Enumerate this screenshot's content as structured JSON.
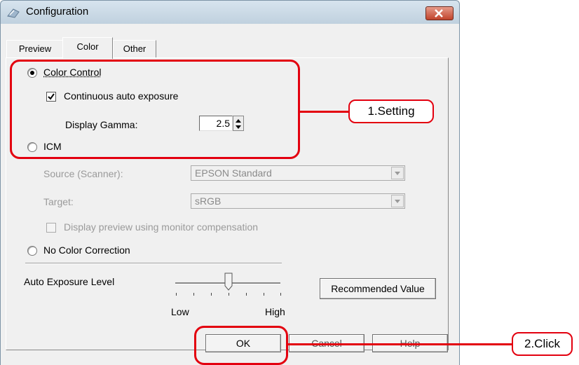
{
  "window": {
    "title": "Configuration"
  },
  "tabs": [
    {
      "label": "Preview",
      "active": false
    },
    {
      "label": "Color",
      "active": true
    },
    {
      "label": "Other",
      "active": false
    }
  ],
  "color_control": {
    "label": "Color Control",
    "selected": true,
    "continuous_auto_exposure": {
      "label": "Continuous auto exposure",
      "checked": true
    },
    "display_gamma": {
      "label": "Display Gamma:",
      "value": "2.5"
    }
  },
  "icm": {
    "label": "ICM",
    "selected": false,
    "source": {
      "label": "Source (Scanner):",
      "value": "EPSON Standard"
    },
    "target": {
      "label": "Target:",
      "value": "sRGB"
    },
    "display_preview": {
      "label": "Display preview using monitor compensation",
      "checked": false
    }
  },
  "no_color_correction": {
    "label": "No Color Correction",
    "selected": false
  },
  "auto_exposure": {
    "label": "Auto Exposure Level",
    "level_fraction": 0.5,
    "low_label": "Low",
    "high_label": "High",
    "recommended_button": "Recommended Value"
  },
  "buttons": {
    "ok": "OK",
    "cancel": "Cancel",
    "help": "Help"
  },
  "callouts": {
    "setting": "1.Setting",
    "click": "2.Click"
  },
  "colors": {
    "callout_red": "#e3000f",
    "dialog_bg": "#f0f0f0",
    "titlebar": "#c6d6e3"
  }
}
